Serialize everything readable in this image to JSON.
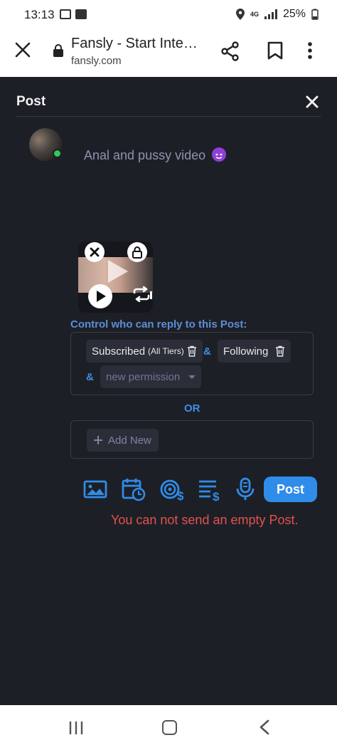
{
  "status_bar": {
    "time": "13:13",
    "network": "4G",
    "battery": "25%"
  },
  "browser": {
    "title": "Fansly - Start Inte…",
    "url": "fansly.com"
  },
  "compose": {
    "header_title": "Post",
    "post_text": "Anal and pussy video",
    "reply_label": "Control who can reply to this Post:",
    "permissions": [
      {
        "label": "Subscribed",
        "sub": "(All Tiers)"
      },
      {
        "label": "Following"
      }
    ],
    "amp": "&",
    "new_permission_placeholder": "new permission",
    "or_label": "OR",
    "add_new_label": "Add New",
    "post_button": "Post",
    "error_text": "You can not send an empty Post."
  },
  "colors": {
    "accent": "#2f8ce8",
    "error": "#e0534f",
    "background": "#1d1f26",
    "online": "#34c759"
  },
  "icons": [
    "close-icon",
    "lock-icon",
    "share-icon",
    "bookmark-icon",
    "more-vert-icon",
    "image-icon",
    "schedule-icon",
    "tip-goal-icon",
    "price-list-icon",
    "microphone-icon",
    "play-icon",
    "repeat-icon",
    "trash-icon",
    "plus-icon"
  ]
}
